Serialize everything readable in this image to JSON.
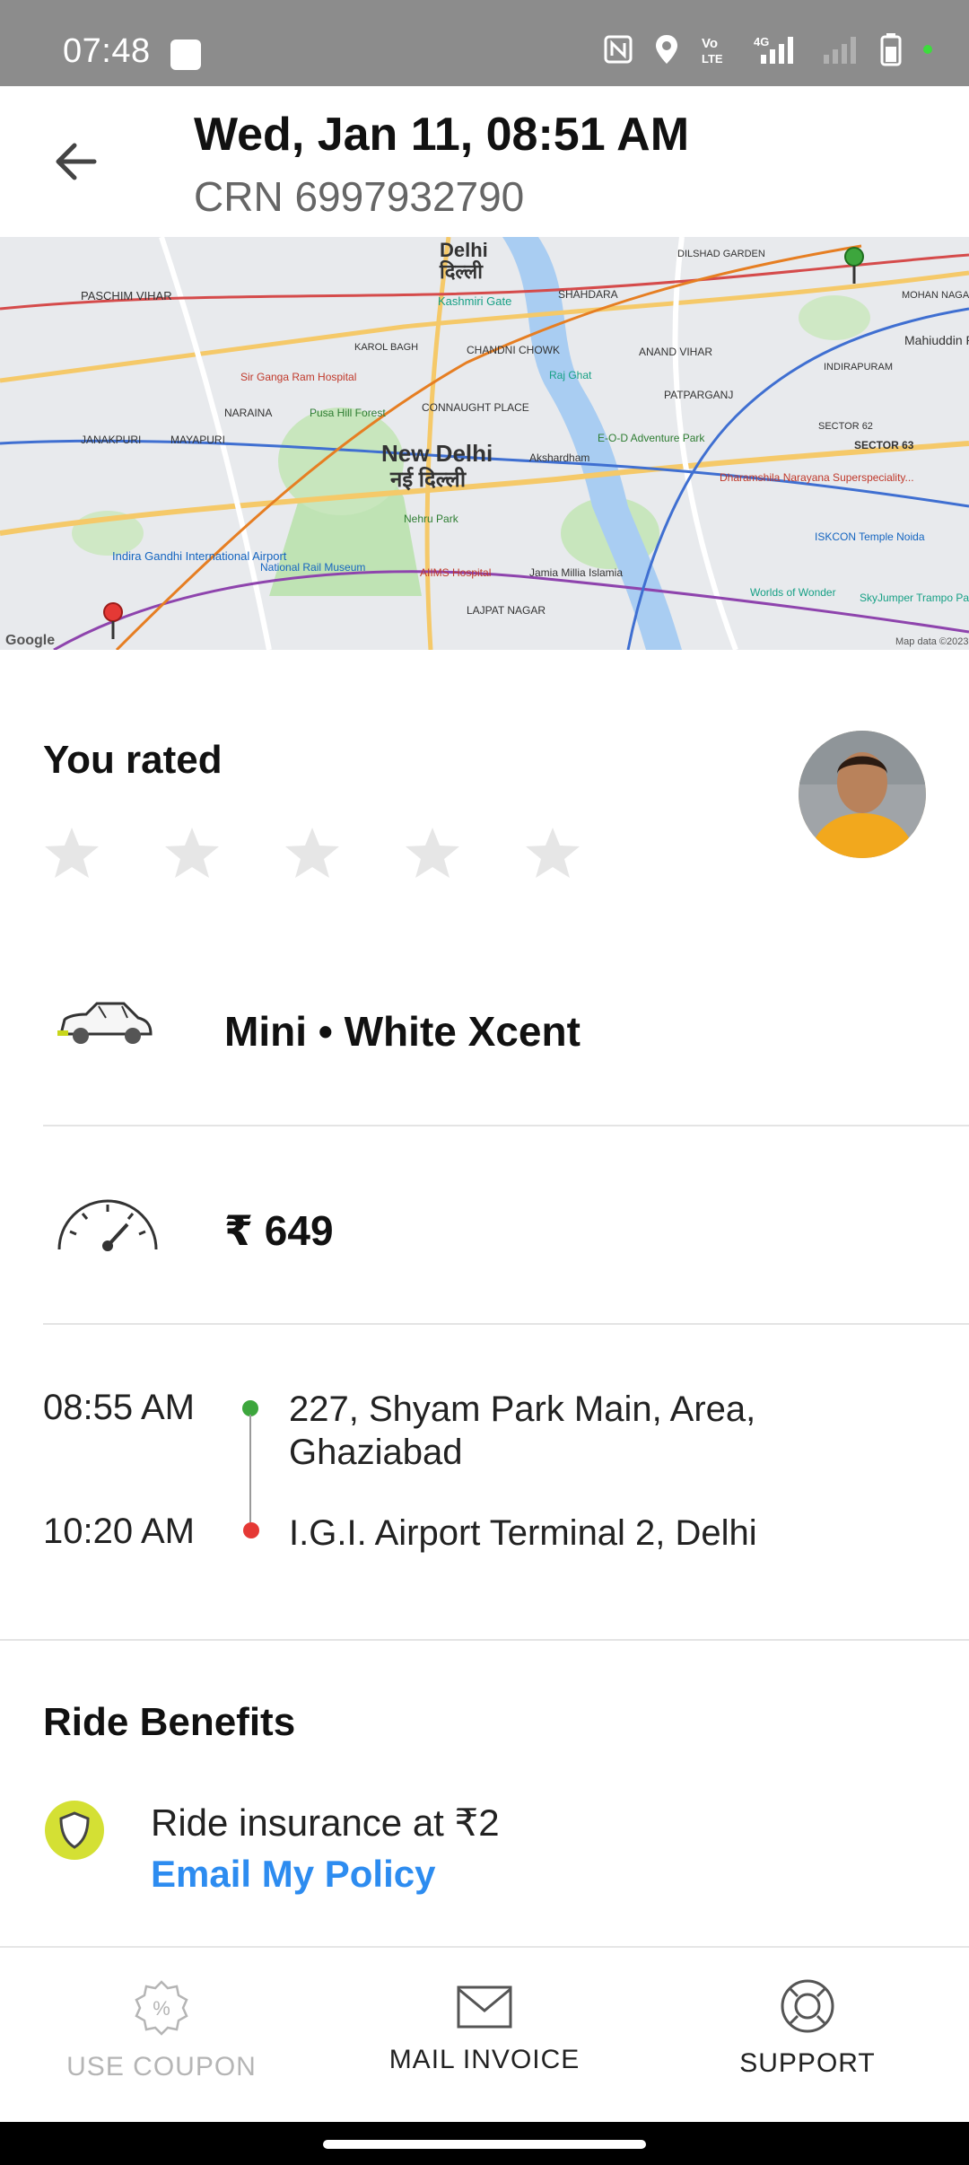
{
  "status_bar": {
    "time": "07:48"
  },
  "header": {
    "title": "Wed, Jan 11, 08:51 AM",
    "crn": "CRN 6997932790"
  },
  "map": {
    "label_delhi": "Delhi",
    "label_delhi_hi": "दिल्ली",
    "label_new_delhi": "New Delhi",
    "label_new_delhi_hi": "नई दिल्ली",
    "label_paschim_vihar": "PASCHIM VIHAR",
    "label_karol_bagh": "KAROL BAGH",
    "label_shahdara": "SHAHDARA",
    "label_anand_vihar": "ANAND VIHAR",
    "label_connaught": "CONNAUGHT PLACE",
    "label_sir_ganga": "Sir Ganga Ram Hospital",
    "label_raj_ghat": "Raj Ghat",
    "label_akshardham": "Akshardham",
    "label_naraina": "NARAINA",
    "label_mayapuri": "MAYAPURI",
    "label_janakpuri": "JANAKPURI",
    "label_pusa": "Pusa Hill Forest",
    "label_nehru_park": "Nehru Park",
    "label_airport": "Indira Gandhi International Airport",
    "label_rail_museum": "National Rail Museum",
    "label_aiims": "AIIMS Hospital",
    "label_lajpat": "LAJPAT NAGAR",
    "label_jamia": "Jamia Millia Islamia",
    "label_dharamshila": "Dharamshila Narayana Superspeciality...",
    "label_iskcon": "ISKCON Temple Noida",
    "label_worlds": "Worlds of Wonder",
    "label_skyjumper": "SkyJumper Trampo Park - Noida Spectru",
    "label_sector62": "SECTOR 62",
    "label_sector63": "SECTOR 63",
    "label_indirapuram": "INDIRAPURAM",
    "label_dilshad": "DILSHAD GARDEN",
    "label_mohan": "MOHAN NAGAR",
    "label_patparganj": "PATPARGANJ",
    "label_eod": "E-O-D Adventure Park",
    "label_mahiuddin": "Mahiuddin Pur Kanawni",
    "label_kashmiri": "Kashmiri Gate",
    "label_chandni": "CHANDNI CHOWK",
    "label_google": "Google",
    "label_mapdata": "Map data ©2023"
  },
  "rating": {
    "title": "You rated",
    "stars_total": 5,
    "stars_filled": 0
  },
  "ride": {
    "vehicle": "Mini • White Xcent",
    "fare": "₹ 649"
  },
  "trip": {
    "pickup_time": "08:55 AM",
    "pickup_address": "227, Shyam Park Main, Area, Ghaziabad",
    "drop_time": "10:20 AM",
    "drop_address": "I.G.I. Airport Terminal 2, Delhi"
  },
  "benefits": {
    "title": "Ride Benefits",
    "insurance": "Ride insurance at ₹2",
    "email_policy": "Email My Policy"
  },
  "bottom_actions": {
    "coupon": "USE COUPON",
    "invoice": "MAIL INVOICE",
    "support": "SUPPORT"
  },
  "colors": {
    "accent_blue": "#2d8cf0",
    "pickup_green": "#3da63d",
    "drop_red": "#e53935",
    "shield_yellow": "#d4e034",
    "status_bar": "#8c8c8c"
  }
}
